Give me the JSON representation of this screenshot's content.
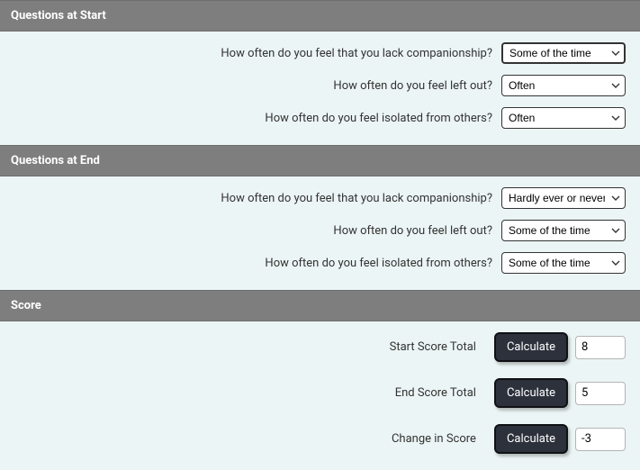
{
  "select_options": [
    "Hardly ever or never",
    "Some of the time",
    "Often"
  ],
  "sections": {
    "start": {
      "header": "Questions at Start",
      "q1": {
        "label": "How often do you feel that you lack companionship?",
        "value": "Some of the time"
      },
      "q2": {
        "label": "How often do you feel left out?",
        "value": "Often"
      },
      "q3": {
        "label": "How often do you feel isolated from others?",
        "value": "Often"
      }
    },
    "end": {
      "header": "Questions at End",
      "q1": {
        "label": "How often do you feel that you lack companionship?",
        "value": "Hardly ever or never"
      },
      "q2": {
        "label": "How often do you feel left out?",
        "value": "Some of the time"
      },
      "q3": {
        "label": "How often do you feel isolated from others?",
        "value": "Some of the time"
      }
    },
    "score": {
      "header": "Score",
      "start_total": {
        "label": "Start Score Total",
        "button": "Calculate",
        "value": "8"
      },
      "end_total": {
        "label": "End Score Total",
        "button": "Calculate",
        "value": "5"
      },
      "change": {
        "label": "Change in Score",
        "button": "Calculate",
        "value": "-3"
      }
    }
  }
}
